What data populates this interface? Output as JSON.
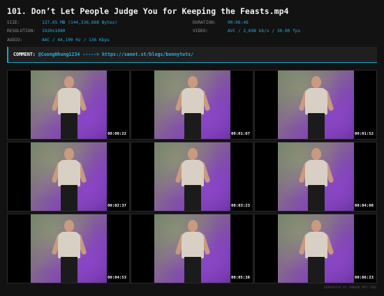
{
  "title": "101. Don’t Let People Judge You for Keeping the Feasts.mp4",
  "meta": {
    "size_label": "SIZE:",
    "size_value": "137.65 MB (144,336,668 Bytes)",
    "resolution_label": "RESOLUTION:",
    "resolution_value": "1920x1080",
    "audio_label": "AUDIO:",
    "audio_value": "AAC / 44,100 Hz / 136 Kbps",
    "duration_label": "DURATION:",
    "duration_value": "00:06:46",
    "video_label": "VIDEO:",
    "video_value": "AVC / 2,698 kb/s / 30.00 fps"
  },
  "comment": {
    "label": "COMMENT:",
    "value": "@CuongNhung1234 -----> https://sanet.st/blogs/bonnytuts/"
  },
  "thumbnails": [
    {
      "timestamp": "00:00:22"
    },
    {
      "timestamp": "00:01:07"
    },
    {
      "timestamp": "00:01:52"
    },
    {
      "timestamp": "00:02:37"
    },
    {
      "timestamp": "00:03:23"
    },
    {
      "timestamp": "00:04:08"
    },
    {
      "timestamp": "00:04:53"
    },
    {
      "timestamp": "00:05:38"
    },
    {
      "timestamp": "00:06:23"
    }
  ],
  "footer": "GENERATED BY SANDOR MPV-TOOL",
  "colors": {
    "background": "#121212",
    "accent": "#29a9e0",
    "label": "#8d8d8d"
  }
}
